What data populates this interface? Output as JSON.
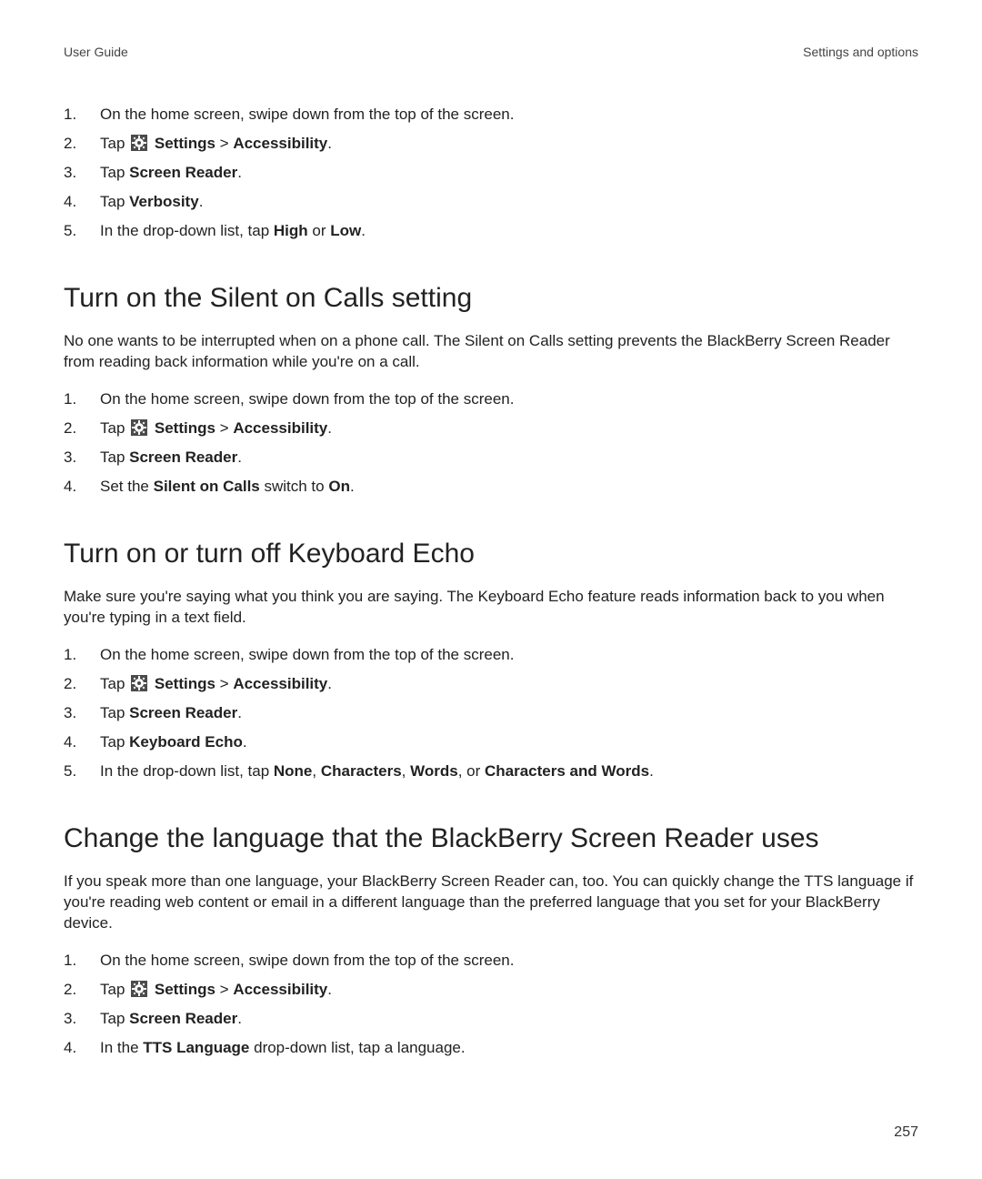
{
  "header": {
    "left": "User Guide",
    "right": "Settings and options"
  },
  "page_number": "257",
  "common": {
    "swipe": "On the home screen, swipe down from the top of the screen.",
    "tap_prefix": "Tap ",
    "settings": "Settings",
    "breadcrumb_sep": " > ",
    "accessibility": "Accessibility",
    "period": ".",
    "tap_b": "Screen Reader",
    "set_prefix": "Set the ",
    "switch_to": " switch to ",
    "on": "On",
    "in_dd_prefix": "In the drop-down list, tap ",
    "or_word": " or ",
    "comma_sep": ", ",
    "in_the": "In the ",
    "dd_suffix": " drop-down list, tap a language."
  },
  "top_list": {
    "step4_b": "Verbosity",
    "step5_opt1": "High",
    "step5_opt2": "Low"
  },
  "sec_silent": {
    "title": "Turn on the Silent on Calls setting",
    "para": "No one wants to be interrupted when on a phone call. The Silent on Calls setting prevents the BlackBerry Screen Reader from reading back information while you're on a call.",
    "step4_b": "Silent on Calls"
  },
  "sec_echo": {
    "title": "Turn on or turn off Keyboard Echo",
    "para": "Make sure you're saying what you think you are saying. The Keyboard Echo feature reads information back to you when you're typing in a text field.",
    "step4_b": "Keyboard Echo",
    "opt1": "None",
    "opt2": "Characters",
    "opt3": "Words",
    "opt4": "Characters and Words"
  },
  "sec_lang": {
    "title": "Change the language that the BlackBerry Screen Reader uses",
    "para": "If you speak more than one language, your BlackBerry Screen Reader can, too. You can quickly change the TTS language if you're reading web content or email in a different language than the preferred language that you set for your BlackBerry device.",
    "step4_b": "TTS Language"
  }
}
